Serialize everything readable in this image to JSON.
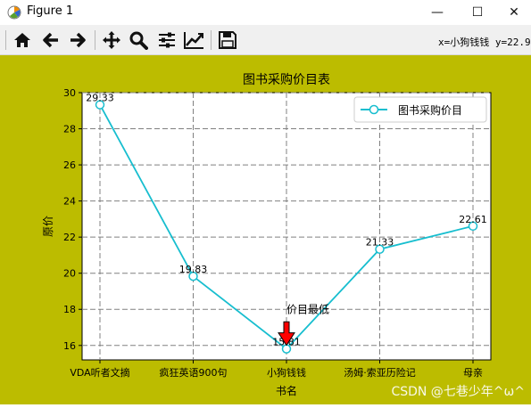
{
  "window": {
    "title": "Figure 1",
    "controls": {
      "minimize": "—",
      "maximize": "☐",
      "close": "✕"
    }
  },
  "toolbar": {
    "buttons": [
      "home-icon",
      "back-icon",
      "forward-icon",
      "pan-icon",
      "zoom-icon",
      "configure-subplots-icon",
      "edit-axis-icon",
      "save-icon"
    ],
    "coordinate_readout": "x=小狗钱钱 y=22.9"
  },
  "colors": {
    "figure_background": "#bcbc00",
    "line": "#17becf",
    "arrow": "#ff0000",
    "grid": "#808080"
  },
  "chart_data": {
    "type": "line",
    "title": "图书采购价目表",
    "xlabel": "书名",
    "ylabel": "原价",
    "categories": [
      "VDA听者文摘",
      "疯狂英语900句",
      "小狗钱钱",
      "汤姆·索亚历险记",
      "母亲"
    ],
    "series": [
      {
        "name": "图书采购价目",
        "values": [
          29.33,
          19.83,
          15.81,
          21.33,
          22.61
        ],
        "marker": "circle"
      }
    ],
    "data_labels": [
      "29.33",
      "19.83",
      "15.81",
      "21.33",
      "22.61"
    ],
    "ylim": [
      15.2,
      30
    ],
    "yticks": [
      "16",
      "18",
      "20",
      "22",
      "24",
      "26",
      "28",
      "30"
    ],
    "grid": true,
    "grid_style": "dashed",
    "legend_position": "upper right",
    "annotation": {
      "text": "价目最低",
      "x": "小狗钱钱",
      "y": 15.81,
      "text_y": 17.8
    }
  },
  "watermark": "CSDN @七巷少年^ω^"
}
